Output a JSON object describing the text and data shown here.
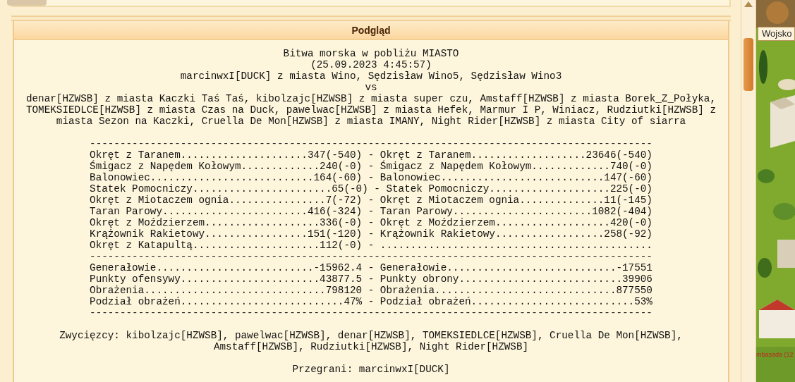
{
  "panel": {
    "title": "Podgląd"
  },
  "report": {
    "header_lines": [
      "Bitwa morska w pobliżu MIASTO",
      "(25.09.2023 4:45:57)",
      "marcinwxI[DUCK] z miasta Wino, Sędzisław Wino5, Sędzisław Wino3",
      "vs",
      "denar[HZWSB] z miasta Kaczki Taś Taś, kibolzajc[HZWSB] z miasta super czu, Amstaff[HZWSB] z miasta Borek_Z_Połyka, TOMEKSIEDLCE[HZWSB] z miasta Czas na Duck, pawelwac[HZWSB] z miasta Hefek, Marmur I P, Winiacz, Rudziutki[HZWSB] z miasta Sezon na Kaczki, Cruella De Mon[HZWSB] z miasta IMANY, Night Rider[HZWSB] z miasta City of siarra"
    ],
    "lines": [
      {
        "kind": "divider",
        "text": "---------------------------------------------------------------------------------------------"
      },
      {
        "kind": "row",
        "text": "Okręt z Taranem.....................347(-540) - Okręt z Taranem...................23646(-540)"
      },
      {
        "kind": "row",
        "text": "Śmigacz z Napędem Kołowym.............240(-0) - Śmigacz z Napędem Kołowym.............740(-0)"
      },
      {
        "kind": "row",
        "text": "Balonowiec...........................164(-60) - Balonowiec...........................147(-60)"
      },
      {
        "kind": "row",
        "text": "Statek Pomocniczy.......................65(-0) - Statek Pomocniczy....................225(-0)"
      },
      {
        "kind": "row",
        "text": "Okręt z Miotaczem ognia................7(-72) - Okręt z Miotaczem ognia..............11(-145)"
      },
      {
        "kind": "row",
        "text": "Taran Parowy........................416(-324) - Taran Parowy.......................1082(-404)"
      },
      {
        "kind": "row",
        "text": "Okręt z Moździerzem...................336(-0) - Okręt z Moździerzem...................420(-0)"
      },
      {
        "kind": "row",
        "text": "Krążownik Rakietowy.................151(-120) - Krążownik Rakietowy..................258(-92)"
      },
      {
        "kind": "row",
        "text": "Okręt z Katapultą.....................112(-0) - ............................................."
      },
      {
        "kind": "divider",
        "text": "---------------------------------------------------------------------------------------------"
      },
      {
        "kind": "row",
        "text": "Generałowie..........................-15962.4 - Generałowie............................-17551"
      },
      {
        "kind": "row",
        "text": "Punkty ofensywy.......................43877.5 - Punkty obrony...........................39906"
      },
      {
        "kind": "row",
        "text": "Obrażenia..............................798120 - Obrażenia..............................877550"
      },
      {
        "kind": "row",
        "text": "Podział obrażeń...........................47% - Podział obrażeń...........................53%"
      },
      {
        "kind": "divider",
        "text": "---------------------------------------------------------------------------------------------"
      }
    ],
    "winners": "Zwycięzcy: kibolzajc[HZWSB], pawelwac[HZWSB], denar[HZWSB], TOMEKSIEDLCE[HZWSB], Cruella De Mon[HZWSB], Amstaff[HZWSB], Rudziutki[HZWSB], Night Rider[HZWSB]",
    "losers": "Przegrani: marcinwxI[DUCK]"
  },
  "side": {
    "button": "Wojsko",
    "label": "mbasada (12"
  }
}
